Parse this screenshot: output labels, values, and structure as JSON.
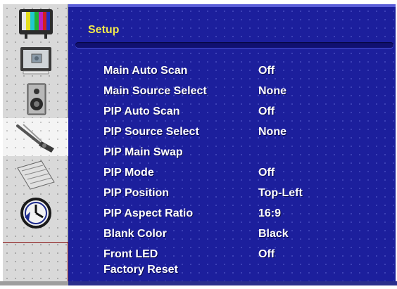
{
  "header": {
    "title": "Setup"
  },
  "sidebar": {
    "items": [
      {
        "icon": "test-pattern-icon",
        "active": false
      },
      {
        "icon": "monitor-picture-icon",
        "active": false
      },
      {
        "icon": "speaker-icon",
        "active": false
      },
      {
        "icon": "tools-icon",
        "active": true
      },
      {
        "icon": "notepad-icon",
        "active": false
      },
      {
        "icon": "clock-icon",
        "active": false
      },
      {
        "icon": "blank-slot",
        "active": false
      }
    ]
  },
  "menu": {
    "items": [
      {
        "label": "Main Auto Scan",
        "value": "Off"
      },
      {
        "label": "Main Source Select",
        "value": "None"
      },
      {
        "label": "PIP Auto Scan",
        "value": "Off"
      },
      {
        "label": "PIP Source Select",
        "value": "None"
      },
      {
        "label": "PIP Main Swap",
        "value": ""
      },
      {
        "label": "PIP Mode",
        "value": "Off"
      },
      {
        "label": "PIP Position",
        "value": "Top-Left"
      },
      {
        "label": "PIP Aspect Ratio",
        "value": "16:9"
      },
      {
        "label": "Blank Color",
        "value": "Black"
      },
      {
        "label": "Front LED",
        "value": "Off"
      },
      {
        "label": "Factory Reset",
        "value": ""
      }
    ]
  },
  "colors": {
    "panel_bg": "#1c1f9c",
    "title_color": "#f0e84c",
    "text_color": "#ffffff"
  }
}
